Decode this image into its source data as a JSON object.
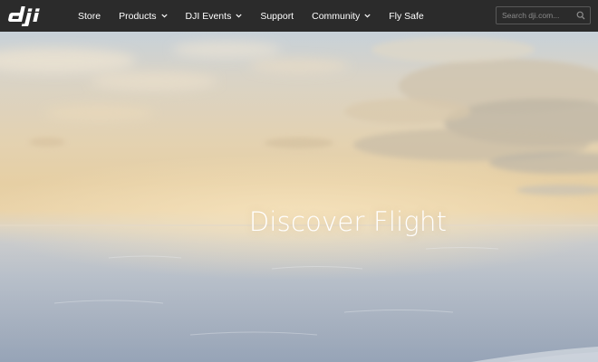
{
  "header": {
    "logo_text": "dji",
    "nav": [
      {
        "label": "Store",
        "has_dropdown": false
      },
      {
        "label": "Products",
        "has_dropdown": true
      },
      {
        "label": "DJI Events",
        "has_dropdown": true
      },
      {
        "label": "Support",
        "has_dropdown": false
      },
      {
        "label": "Community",
        "has_dropdown": true
      },
      {
        "label": "Fly Safe",
        "has_dropdown": false
      }
    ],
    "search": {
      "placeholder": "Search dji.com..."
    }
  },
  "hero": {
    "title": "Discover Flight"
  },
  "icons": {
    "search": "magnifier-icon",
    "dropdown": "chevron-down-icon"
  },
  "colors": {
    "topbar": "#2b2b2b",
    "nav_text": "#ffffff",
    "hero_title": "#ffffff"
  }
}
